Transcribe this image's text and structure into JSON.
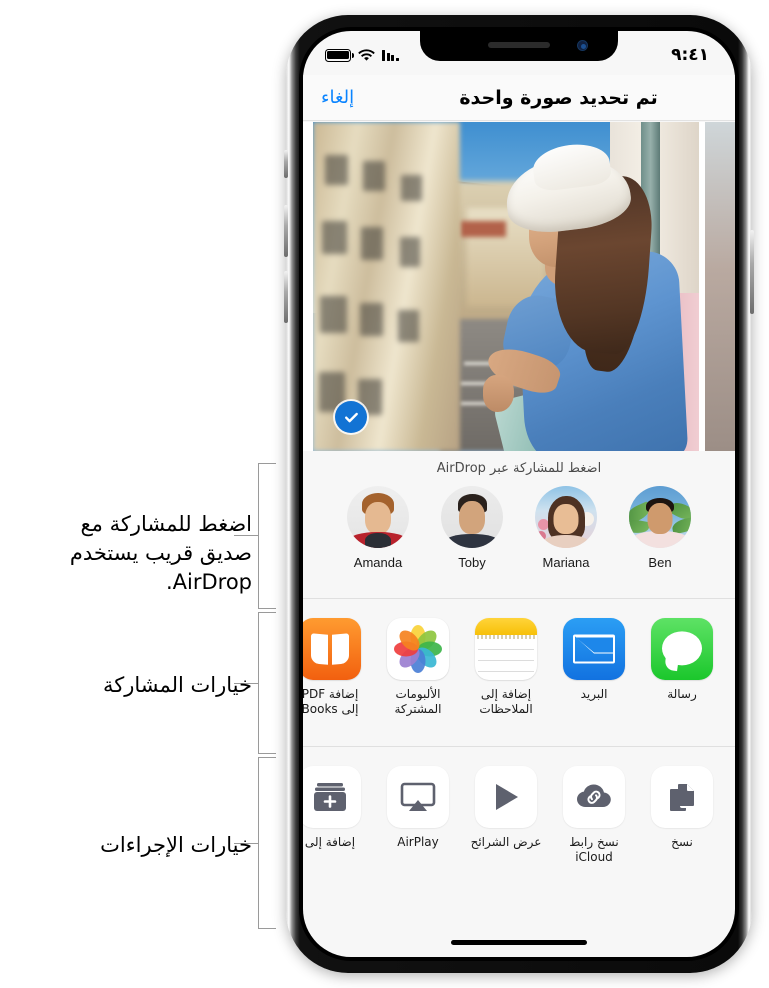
{
  "annotations": [
    {
      "id": "airdrop-note",
      "text": "اضغط للمشاركة مع صديق قريب يستخدم AirDrop."
    },
    {
      "id": "share-note",
      "text": "خيارات المشاركة"
    },
    {
      "id": "actions-note",
      "text": "خيارات الإجراءات"
    }
  ],
  "statusbar": {
    "time": "٩:٤١",
    "battery_icon": "battery-icon",
    "wifi_icon": "wifi-icon",
    "signal_icon": "signal-bars-icon"
  },
  "navbar": {
    "title": "تم تحديد صورة واحدة",
    "cancel_label": "إلغاء",
    "cancel_color": "#0a84ff"
  },
  "photo": {
    "selected_badge_icon": "checkmark-icon",
    "badge_color": "#1273d4",
    "alt": "امرأة ترتدي قبعة بيضاء وقميصاً أزرق تطل على شارع"
  },
  "airdrop": {
    "title": "اضغط للمشاركة عبر AirDrop",
    "contacts": [
      {
        "name": "Ben",
        "avatar": "av-ben"
      },
      {
        "name": "Mariana",
        "avatar": "av-mari"
      },
      {
        "name": "Toby",
        "avatar": "av-toby"
      },
      {
        "name": "Amanda",
        "avatar": "av-amanda"
      }
    ]
  },
  "share_options": [
    {
      "label": "رسالة",
      "icon": "messages-icon"
    },
    {
      "label": "البريد",
      "icon": "mail-icon"
    },
    {
      "label": "إضافة إلى الملاحظات",
      "icon": "notes-icon"
    },
    {
      "label": "الألبومات المشتركة",
      "icon": "photos-icon"
    },
    {
      "label": "إضافة PDF إلى Books",
      "icon": "books-icon"
    }
  ],
  "action_options": [
    {
      "label": "نسخ",
      "icon": "copy-icon"
    },
    {
      "label": "نسخ رابط iCloud",
      "icon": "icloud-link-icon"
    },
    {
      "label": "عرض الشرائح",
      "icon": "slideshow-play-icon"
    },
    {
      "label": "AirPlay",
      "icon": "airplay-icon"
    },
    {
      "label": "إضافة إلى",
      "icon": "add-to-album-icon"
    }
  ]
}
